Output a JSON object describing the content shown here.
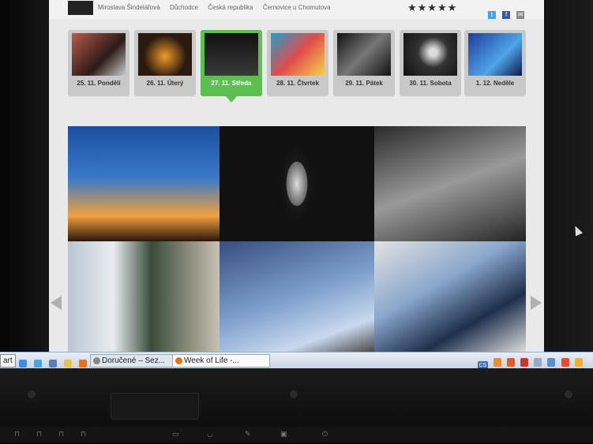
{
  "profile": {
    "name": "Miroslava Šindelářová",
    "occupation": "Důchodce",
    "country": "Česká republika",
    "place": "Černovice u Chomutova",
    "rating_stars": "★★★★★"
  },
  "share": {
    "twitter": "t",
    "facebook": "f",
    "mail": "✉"
  },
  "days": [
    {
      "label": "25. 11. Pondělí",
      "color": "#6a3a32"
    },
    {
      "label": "26. 11. Úterý",
      "color": "#3b2416"
    },
    {
      "label": "27. 11. Středa",
      "color": "#1d1d1d",
      "active": true
    },
    {
      "label": "28. 11. Čtvrtek",
      "color": "#2a8ab8"
    },
    {
      "label": "29. 11. Pátek",
      "color": "#3a3a3a"
    },
    {
      "label": "30. 11. Sobota",
      "color": "#454545"
    },
    {
      "label": "1. 12. Neděle",
      "color": "#2a4fa8"
    }
  ],
  "taskbar": {
    "start": "art",
    "buttons": [
      {
        "label": "Doručené – Sez...",
        "active": false
      },
      {
        "label": "Week of Life -...",
        "active": true
      }
    ],
    "tray_lang": "CS"
  }
}
